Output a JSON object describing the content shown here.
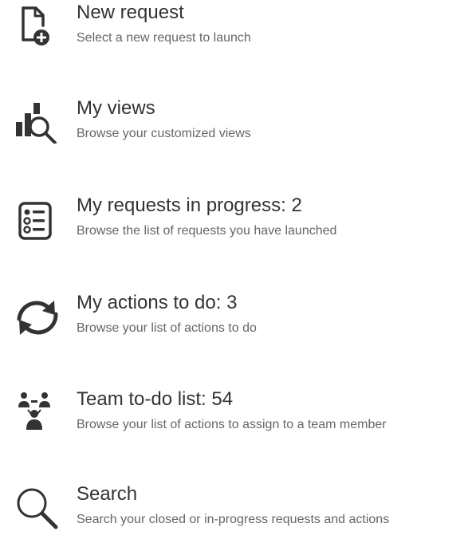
{
  "menu": {
    "items": [
      {
        "title": "New request",
        "description": "Select a new request to launch",
        "icon": "new-document-plus-icon"
      },
      {
        "title": "My views",
        "description": "Browse your customized views",
        "icon": "chart-magnifier-icon"
      },
      {
        "title": "My requests in progress: 2",
        "description": "Browse the list of requests you have launched",
        "icon": "checklist-icon"
      },
      {
        "title": "My actions to do: 3",
        "description": "Browse your list of actions to do",
        "icon": "refresh-cycle-icon"
      },
      {
        "title": "Team to-do list: 54",
        "description": "Browse your list of actions to assign to a team member",
        "icon": "team-icon"
      },
      {
        "title": "Search",
        "description": "Search your closed or in-progress requests and actions",
        "icon": "search-icon"
      }
    ]
  },
  "colors": {
    "icon": "#333333",
    "title": "#333333",
    "description": "#666666",
    "background": "#ffffff"
  }
}
